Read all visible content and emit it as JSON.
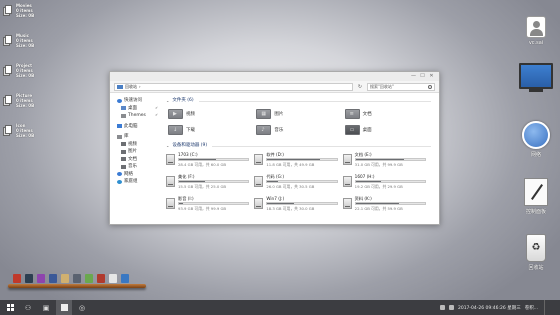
{
  "left_widgets": [
    {
      "name": "Movies",
      "items": "0 items",
      "size": "Size: 0B"
    },
    {
      "name": "Music",
      "items": "0 items",
      "size": "Size: 0B"
    },
    {
      "name": "Project",
      "items": "0 items",
      "size": "Size: 0B"
    },
    {
      "name": "Picture",
      "items": "0 items",
      "size": "Size: 0B"
    },
    {
      "name": "Icon",
      "items": "0 items",
      "size": "Size: 0B"
    }
  ],
  "right_icons": {
    "user": "vc.sai",
    "network": "网络",
    "control_panel": "控制面板",
    "recycle_bin": "回收站"
  },
  "explorer": {
    "address": "回收站",
    "search_placeholder": "搜索\"回收站\"",
    "nav": {
      "quick_access": "快速访问",
      "desktop": "桌面",
      "themes": "Themes",
      "this_pc": "此电脑",
      "library": "库",
      "videos": "视频",
      "pictures": "图片",
      "documents": "文档",
      "music": "音乐",
      "network": "网络",
      "homegroup": "家庭组"
    },
    "folders_header": "文件夹 (6)",
    "folders": [
      {
        "name": "视频",
        "icon": "film-icon"
      },
      {
        "name": "图片",
        "icon": "picture-icon"
      },
      {
        "name": "文档",
        "icon": "document-icon"
      },
      {
        "name": "下载",
        "icon": "download-icon"
      },
      {
        "name": "音乐",
        "icon": "music-icon"
      },
      {
        "name": "桌面",
        "icon": "desktop-icon"
      }
    ],
    "drives_header": "设备和驱动器 (9)",
    "drives": [
      {
        "name": "1703 (C:)",
        "free": "28.4 GB 可用，共 60.0 GB",
        "used": 0.53
      },
      {
        "name": "软件 (D:)",
        "free": "11.8 GB 可用，共 49.9 GB",
        "used": 0.76
      },
      {
        "name": "文档 (E:)",
        "free": "31.0 GB 可用，共 99.9 GB",
        "used": 0.69
      },
      {
        "name": "美化 (F:)",
        "free": "15.5 GB 可用，共 25.0 GB",
        "used": 0.38
      },
      {
        "name": "代码 (G:)",
        "free": "26.0 GB 可用，共 30.5 GB",
        "used": 0.15
      },
      {
        "name": "1607 (H:)",
        "free": "19.2 GB 可用，共 29.9 GB",
        "used": 0.36
      },
      {
        "name": "影音 (I:)",
        "free": "93.9 GB 可用，共 99.9 GB",
        "used": 0.06
      },
      {
        "name": "Win7 (J:)",
        "free": "18.3 GB 可用，共 30.0 GB",
        "used": 0.39
      },
      {
        "name": "资料 (K:)",
        "free": "22.1 GB 可用，共 59.9 GB",
        "used": 0.63
      }
    ]
  },
  "dock_colors": [
    "#c0392b",
    "#2c3e50",
    "#8e44ad",
    "#3b5998",
    "#d0b070",
    "#5a6270",
    "#6aa84f",
    "#b03a2e",
    "#e6e6e6",
    "#3a78c2"
  ],
  "taskbar": {
    "clock": "2017-04-26  09:46:26 星期三",
    "tray_text": "卷积..."
  }
}
